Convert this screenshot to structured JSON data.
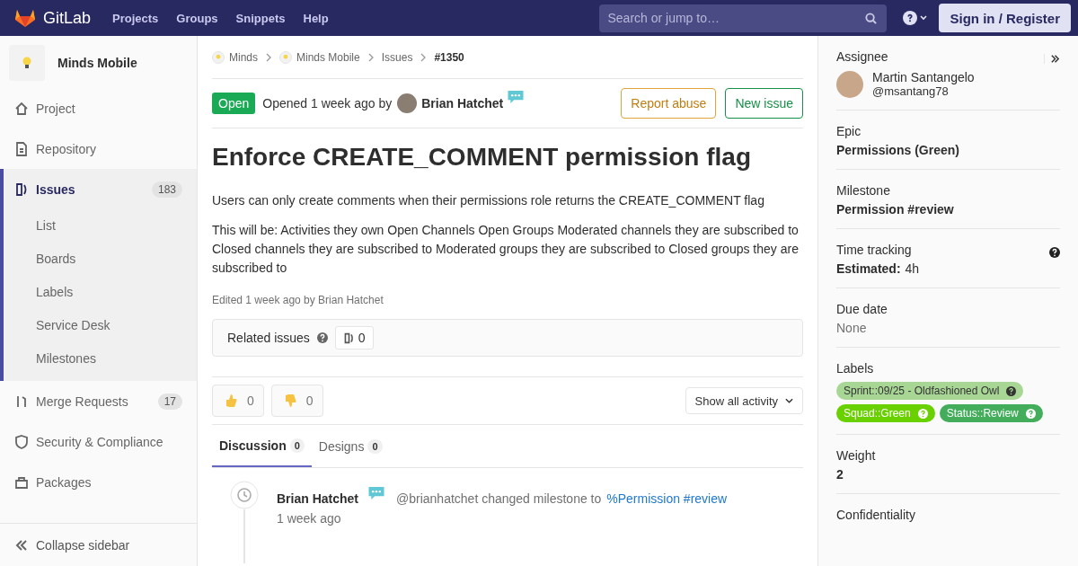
{
  "header": {
    "brand": "GitLab",
    "nav": [
      "Projects",
      "Groups",
      "Snippets",
      "Help"
    ],
    "search": {
      "placeholder": "Search or jump to…"
    },
    "sign_in": "Sign in / Register"
  },
  "sidebar": {
    "project": "Minds Mobile",
    "items": [
      {
        "label": "Project",
        "selected": false
      },
      {
        "label": "Repository",
        "selected": false
      },
      {
        "label": "Issues",
        "count": "183",
        "selected": true,
        "children": [
          {
            "label": "List"
          },
          {
            "label": "Boards"
          },
          {
            "label": "Labels"
          },
          {
            "label": "Service Desk"
          },
          {
            "label": "Milestones"
          }
        ]
      },
      {
        "label": "Merge Requests",
        "count": "17",
        "selected": false
      },
      {
        "label": "Security & Compliance",
        "selected": false
      },
      {
        "label": "Packages",
        "selected": false
      }
    ],
    "collapse": "Collapse sidebar"
  },
  "breadcrumbs": [
    "Minds",
    "Minds Mobile",
    "Issues",
    "#1350"
  ],
  "issue": {
    "status": "Open",
    "opened": "Opened 1 week ago by",
    "author": "Brian Hatchet",
    "buttons": [
      "Report abuse",
      "New issue"
    ],
    "title": "Enforce CREATE_COMMENT permission flag",
    "paragraphs": [
      "Users can only create comments when their permissions role returns the CREATE_COMMENT flag",
      "This will be: Activities they own Open Channels Open Groups Moderated channels they are subscribed to Closed channels they are subscribed to Moderated groups they are subscribed to Closed groups they are subscribed to"
    ],
    "edited": "Edited 1 week ago by Brian Hatchet"
  },
  "related": {
    "label": "Related issues",
    "count": "0"
  },
  "awards": [
    {
      "kind": "up",
      "count": "0"
    },
    {
      "kind": "down",
      "count": "0"
    }
  ],
  "activity_filter": "Show all activity",
  "tabs": [
    {
      "label": "Discussion",
      "count": "0",
      "selected": true
    },
    {
      "label": "Designs",
      "count": "0",
      "selected": false
    }
  ],
  "notes": [
    {
      "author": "Brian Hatchet",
      "text": "@brianhatchet changed milestone to",
      "link": "%Permission #review",
      "time": "1 week ago"
    }
  ],
  "right": {
    "assignee": {
      "heading": "Assignee",
      "name": "Martin Santangelo",
      "handle": "@msantang78"
    },
    "epic": {
      "heading": "Epic",
      "value": "Permissions (Green)"
    },
    "milestone": {
      "heading": "Milestone",
      "value": "Permission #review"
    },
    "time": {
      "heading": "Time tracking",
      "label": "Estimated:",
      "value": "4h"
    },
    "due": {
      "heading": "Due date",
      "value": "None"
    },
    "labels": {
      "heading": "Labels",
      "items": [
        {
          "text": "Sprint::09/25 - Oldfashioned Owl",
          "color": "#a8d695"
        },
        {
          "text": "Squad::Green",
          "color": "#69d100"
        },
        {
          "text": "Status::Review",
          "color": "#44ad5c"
        }
      ]
    },
    "weight": {
      "heading": "Weight",
      "value": "2"
    },
    "confidentiality": {
      "heading": "Confidentiality"
    }
  }
}
